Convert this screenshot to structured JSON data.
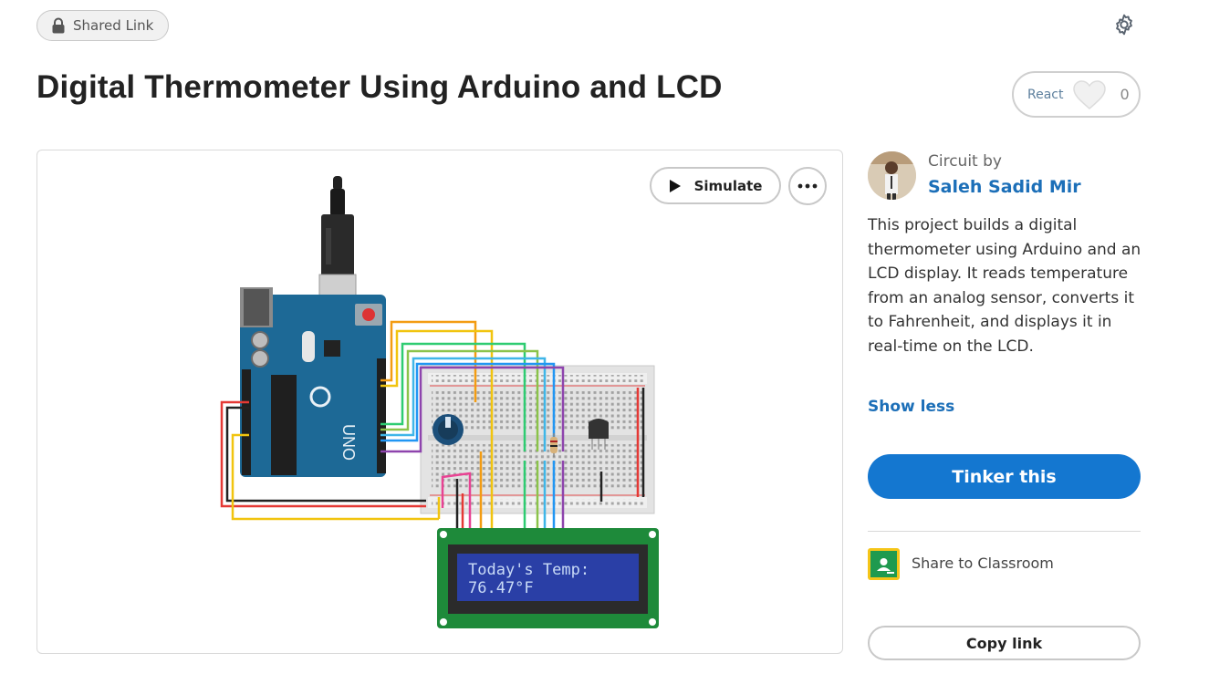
{
  "header": {
    "shared_label": "Shared Link",
    "title": "Digital Thermometer Using Arduino and LCD",
    "react_label": "React",
    "react_count": "0"
  },
  "canvas": {
    "simulate_label": "Simulate",
    "lcd_line1": "Today's Temp:",
    "lcd_line2": "76.47°F"
  },
  "sidebar": {
    "circuit_by": "Circuit by",
    "author": "Saleh Sadid Mir",
    "description": "This project builds a digital thermometer using Arduino and an LCD display. It reads temperature from an analog sensor, converts it to Fahrenheit, and displays it in real-time on the LCD.",
    "show_less": "Show less",
    "tinker_label": "Tinker this",
    "share_classroom": "Share to Classroom",
    "copy_link": "Copy link"
  },
  "colors": {
    "accent": "#1477d0",
    "link": "#1c6fb8",
    "arduino": "#1d6996",
    "lcd_screen": "#2a3fa6",
    "lcd_board": "#1e8a3a"
  },
  "icons": {
    "lock": "lock-icon",
    "settings": "gear-icon",
    "react": "heart-icon",
    "simulate": "play-icon",
    "more": "more-dots-icon",
    "classroom": "google-classroom-icon"
  }
}
